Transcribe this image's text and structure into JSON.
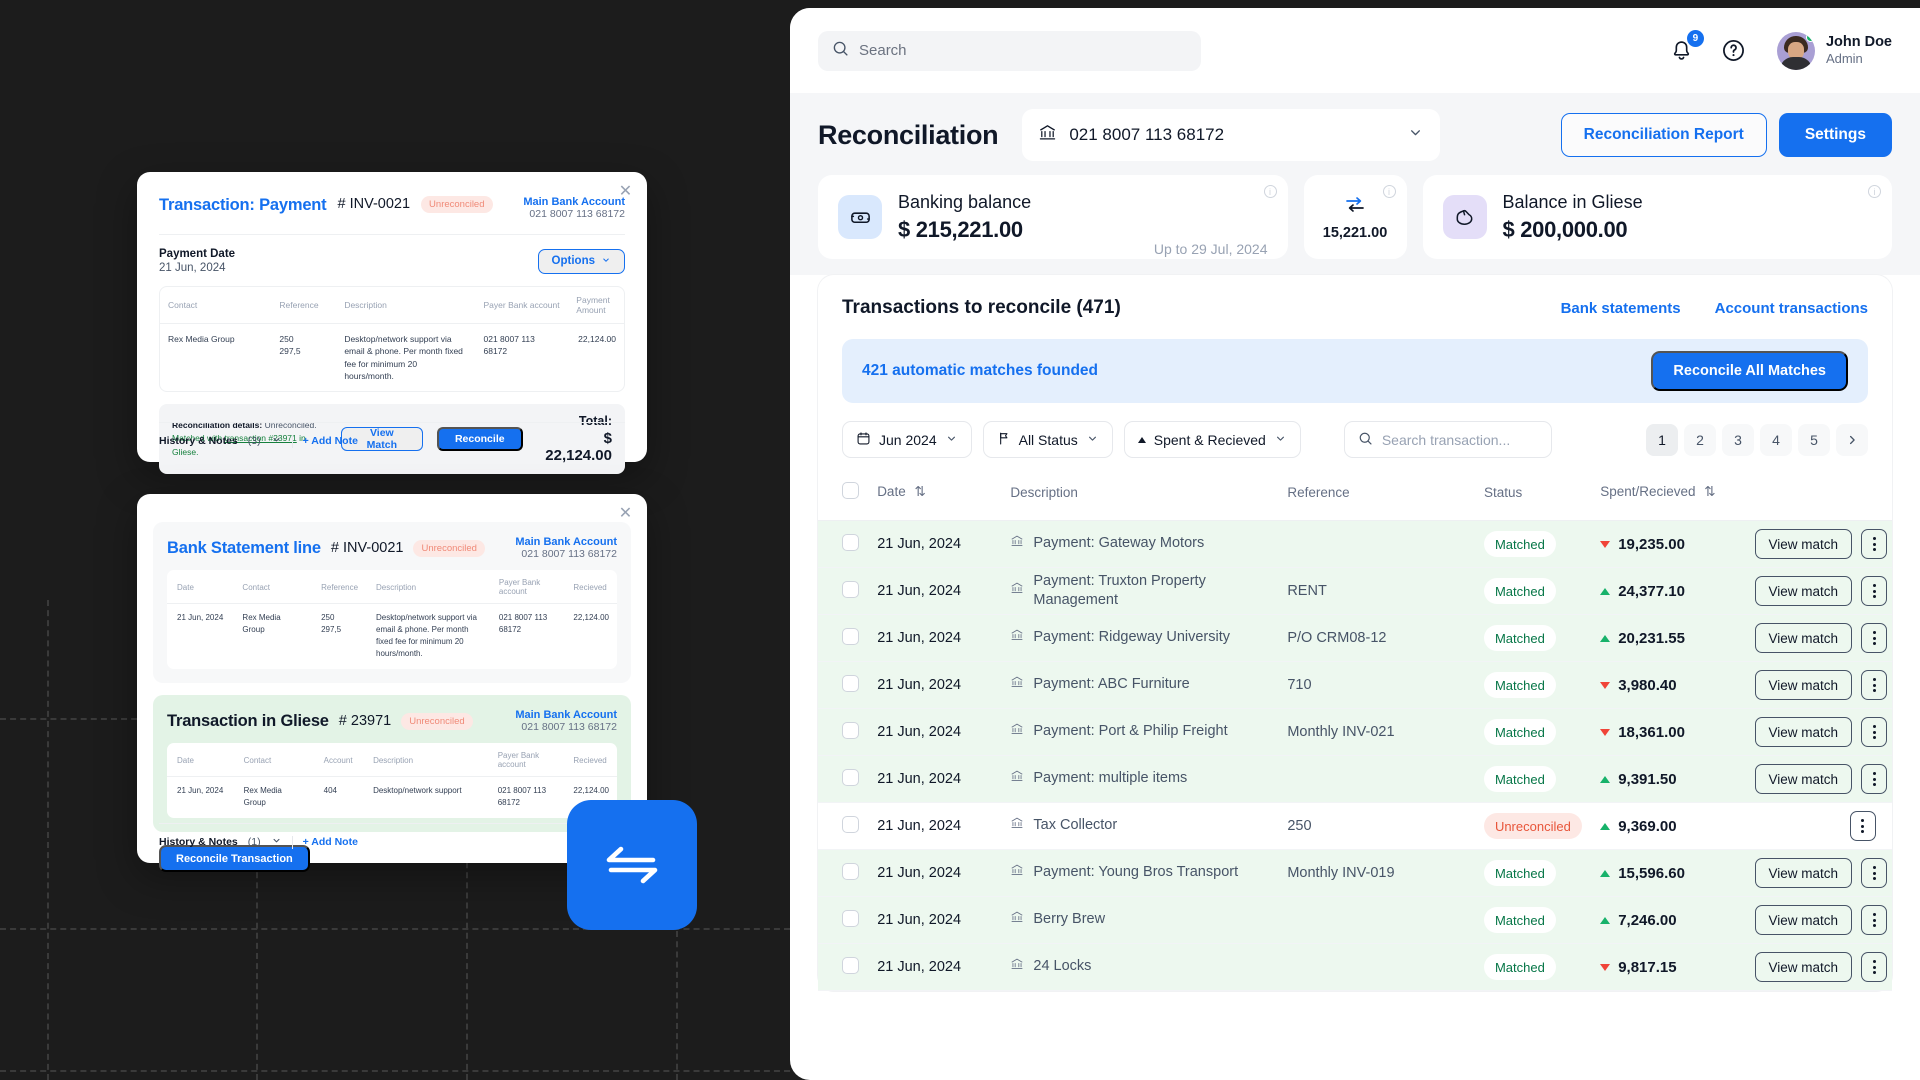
{
  "topbar": {
    "search_placeholder": "Search",
    "search_icon": "search-icon",
    "notification_count": "9",
    "help_icon": "question-mark-icon",
    "user_name": "John Doe",
    "user_role": "Admin"
  },
  "header": {
    "title": "Reconciliation",
    "account_icon": "bank-icon",
    "account_number": "021 8007 113 68172",
    "report_button": "Reconciliation Report",
    "settings_button": "Settings"
  },
  "stats": [
    {
      "icon": "banknote-icon",
      "label": "Banking balance",
      "value": "$ 215,221.00",
      "note": "Up to 29 Jul, 2024"
    },
    {
      "icon": "transfer-arrows-icon",
      "value": "15,221.00"
    },
    {
      "icon": "wallet-icon",
      "label": "Balance in Gliese",
      "value": "$ 200,000.00"
    }
  ],
  "transactions": {
    "title": "Transactions to reconcile (471)",
    "links": [
      "Bank statements",
      "Account transactions"
    ],
    "banner_text": "421 automatic matches founded",
    "banner_button": "Reconcile All Matches",
    "filters": {
      "period": "Jun 2024",
      "status": "All Status",
      "sort": "Spent & Recieved",
      "search_placeholder": "Search transaction..."
    },
    "pages": [
      "1",
      "2",
      "3",
      "4",
      "5"
    ],
    "active_page": "1",
    "columns": [
      "Date",
      "Description",
      "Reference",
      "Status",
      "Spent/Recieved"
    ],
    "rows": [
      {
        "date": "21 Jun, 2024",
        "description": "Payment: Gateway Motors",
        "reference": "",
        "status": "Matched",
        "amount": "19,235.00",
        "direction": "down",
        "action": "View match"
      },
      {
        "date": "21 Jun, 2024",
        "description": "Payment: Truxton Property Management",
        "reference": "RENT",
        "status": "Matched",
        "amount": "24,377.10",
        "direction": "up",
        "action": "View match"
      },
      {
        "date": "21 Jun, 2024",
        "description": "Payment: Ridgeway University",
        "reference": "P/O CRM08-12",
        "status": "Matched",
        "amount": "20,231.55",
        "direction": "up",
        "action": "View match"
      },
      {
        "date": "21 Jun, 2024",
        "description": "Payment: ABC Furniture",
        "reference": "710",
        "status": "Matched",
        "amount": "3,980.40",
        "direction": "down",
        "action": "View match"
      },
      {
        "date": "21 Jun, 2024",
        "description": "Payment: Port & Philip Freight",
        "reference": "Monthly INV-021",
        "status": "Matched",
        "amount": "18,361.00",
        "direction": "down",
        "action": "View match"
      },
      {
        "date": "21 Jun, 2024",
        "description": "Payment: multiple items",
        "reference": "",
        "status": "Matched",
        "amount": "9,391.50",
        "direction": "up",
        "action": "View match"
      },
      {
        "date": "21 Jun, 2024",
        "description": "Tax Collector",
        "reference": "250",
        "status": "Unreconciled",
        "amount": "9,369.00",
        "direction": "up",
        "action": ""
      },
      {
        "date": "21 Jun, 2024",
        "description": "Payment: Young Bros Transport",
        "reference": "Monthly INV-019",
        "status": "Matched",
        "amount": "15,596.60",
        "direction": "up",
        "action": "View match"
      },
      {
        "date": "21 Jun, 2024",
        "description": "Berry Brew",
        "reference": "",
        "status": "Matched",
        "amount": "7,246.00",
        "direction": "up",
        "action": "View match"
      },
      {
        "date": "21 Jun, 2024",
        "description": "24 Locks",
        "reference": "",
        "status": "Matched",
        "amount": "9,817.15",
        "direction": "down",
        "action": "View match"
      }
    ]
  },
  "card_payment": {
    "title": "Transaction: Payment",
    "id": "# INV-0021",
    "badge": "Unreconciled",
    "bank_name": "Main Bank Account",
    "bank_number": "021 8007 113 68172",
    "date_label": "Payment Date",
    "date_value": "21 Jun, 2024",
    "options_button": "Options",
    "columns": [
      "Contact",
      "Reference",
      "Description",
      "Payer Bank account",
      "Payment Amount"
    ],
    "row": {
      "contact": "Rex Media Group",
      "reference": "250\n297,5",
      "description": "Desktop/network support via email & phone. Per month fixed fee for minimum 20 hours/month.",
      "payer_account": "021 8007 113 68172",
      "amount": "22,124.00"
    },
    "recon_label": "Reconciliation details:",
    "recon_status": "Unreconciled.",
    "recon_matched_pre": "Matched with ",
    "recon_matched_link": "transaction #23971",
    "recon_matched_post": " in Gliese.",
    "view_match_button": "View Match",
    "reconcile_button": "Reconcile",
    "total_label": "Total:",
    "total_value": "$ 22,124.00",
    "history_label": "History & Notes",
    "history_count": "(3)",
    "add_note": "+ Add Note"
  },
  "card_statement": {
    "statement": {
      "title": "Bank Statement line",
      "id": "# INV-0021",
      "badge": "Unreconciled",
      "bank_name": "Main Bank Account",
      "bank_number": "021 8007 113 68172",
      "columns": [
        "Date",
        "Contact",
        "Reference",
        "Description",
        "Payer Bank account",
        "Recieved"
      ],
      "row": {
        "date": "21 Jun, 2024",
        "contact": "Rex Media Group",
        "reference": "250\n297,5",
        "description": "Desktop/network support via email & phone. Per month fixed fee for minimum 20 hours/month.",
        "payer_account": "021 8007 113 68172",
        "recieved": "22,124.00"
      }
    },
    "gliese": {
      "title": "Transaction in Gliese",
      "id": "# 23971",
      "badge": "Unreconciled",
      "bank_name": "Main Bank Account",
      "bank_number": "021 8007 113 68172",
      "columns": [
        "Date",
        "Contact",
        "Account",
        "Description",
        "Payer Bank account",
        "Recieved"
      ],
      "row": {
        "date": "21 Jun, 2024",
        "contact": "Rex Media Group",
        "account": "404",
        "description": "Desktop/network support",
        "payer_account": "021 8007 113 68172",
        "recieved": "22,124.00"
      }
    },
    "reconcile_button": "Reconcile Transaction",
    "history_label": "History & Notes",
    "history_count": "(1)",
    "add_note": "+ Add Note"
  },
  "swap_badge_icon": "transfer-swap-icon",
  "colors": {
    "brand_blue": "#1570ef",
    "matched_green": "#067647",
    "matched_row": "#edf8ef",
    "unreconciled_red": "#e8553a",
    "amount_up": "#17b26a",
    "amount_down": "#f04438"
  }
}
